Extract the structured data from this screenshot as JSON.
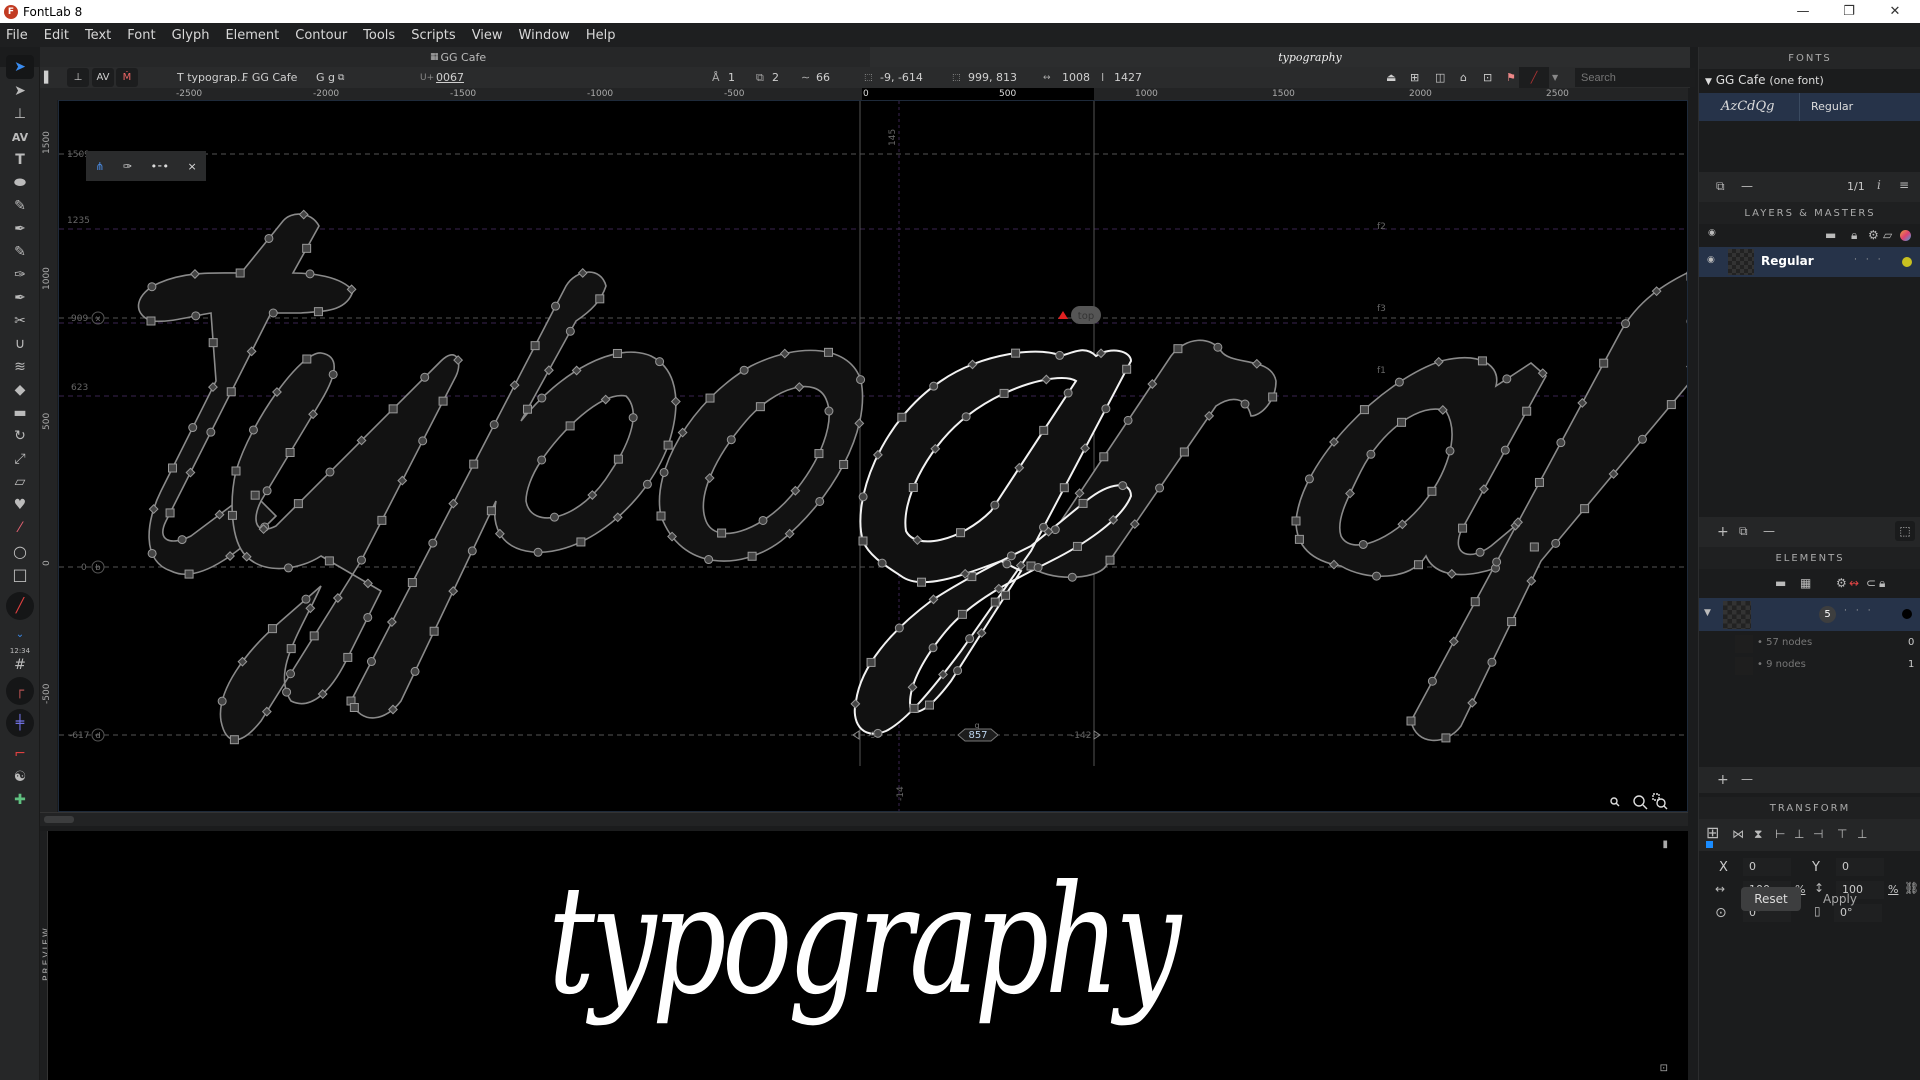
{
  "app": {
    "title": "FontLab 8",
    "logo_letter": "F"
  },
  "window_controls": {
    "minimize": "—",
    "maximize": "❐",
    "close": "✕"
  },
  "menu": [
    "File",
    "Edit",
    "Text",
    "Font",
    "Glyph",
    "Element",
    "Contour",
    "Tools",
    "Scripts",
    "View",
    "Window",
    "Help"
  ],
  "tabs": {
    "font_tab": "GG Cafe",
    "text_tab": "typography"
  },
  "propbar": {
    "text_label": "T typograp...",
    "font_label": "F GG Cafe",
    "glyph_label": "G g",
    "unicode_prefix": "U+",
    "unicode": "0067",
    "anchors": "1",
    "contours": "2",
    "nodes": "66",
    "origin": "-9, -614",
    "extent": "999, 813",
    "width": "1008",
    "height": "1427",
    "search_placeholder": "Search"
  },
  "hruler": [
    "-2500",
    "-2000",
    "-1500",
    "-1000",
    "-500",
    "0",
    "500",
    "1000",
    "1500",
    "2000",
    "2500"
  ],
  "vruler": [
    "1500",
    "1000",
    "500",
    "0",
    "-500"
  ],
  "guides": {
    "ascender": "1509",
    "cap": "1235",
    "xheight": "909",
    "x_label": "x",
    "mid": "623",
    "baseline": "0",
    "baseline_label": "b",
    "descender": "-617",
    "descender_label": "d",
    "left_guide": "145",
    "bottom_guide": "-14",
    "f1": "f1",
    "f2": "f2",
    "f3": "f3"
  },
  "canvas": {
    "anchor_label": "top",
    "glyph_name": "g",
    "advance_width": "857",
    "lsb": "-9",
    "rsb": "-142"
  },
  "preview": {
    "label": "PREVIEW",
    "text": "typography"
  },
  "fonts_panel": {
    "title": "FONTS",
    "family": "GG Cafe",
    "family_note": "(one font)",
    "sample": "AzCdQg",
    "style": "Regular",
    "page": "1/1"
  },
  "layers_panel": {
    "title": "LAYERS & MASTERS",
    "layers": [
      {
        "name": "Regular",
        "color": "#c8c020"
      }
    ]
  },
  "elements_panel": {
    "title": "ELEMENTS",
    "element_count": "5",
    "children": [
      {
        "label": "57 nodes",
        "index": "0"
      },
      {
        "label": "9 nodes",
        "index": "1"
      }
    ]
  },
  "transform_panel": {
    "title": "TRANSFORM",
    "x_label": "X",
    "x": "0",
    "y_label": "Y",
    "y": "0",
    "scale_w": "100",
    "scale_h": "100",
    "pct": "%",
    "rotate": "0°",
    "slant": "0°",
    "reset": "Reset",
    "apply": "Apply"
  }
}
